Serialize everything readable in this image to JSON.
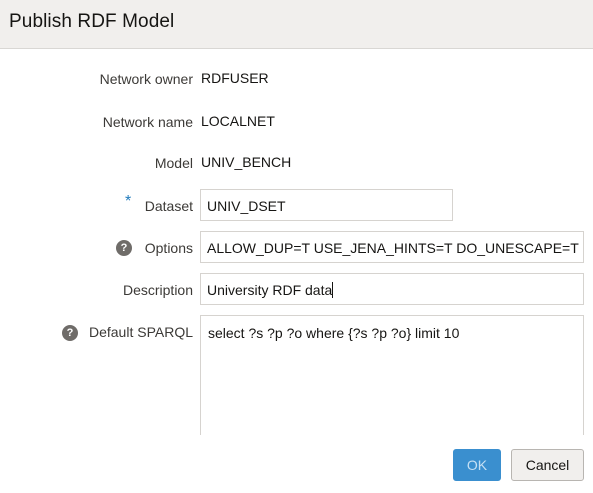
{
  "dialog": {
    "title": "Publish RDF Model"
  },
  "form": {
    "network_owner": {
      "label": "Network owner",
      "value": "RDFUSER"
    },
    "network_name": {
      "label": "Network name",
      "value": "LOCALNET"
    },
    "model": {
      "label": "Model",
      "value": "UNIV_BENCH"
    },
    "dataset": {
      "label": "Dataset",
      "required_marker": "*",
      "value": "UNIV_DSET"
    },
    "options": {
      "label": "Options",
      "help_glyph": "?",
      "value": "ALLOW_DUP=T USE_JENA_HINTS=T DO_UNESCAPE=T"
    },
    "description": {
      "label": "Description",
      "value": "University RDF data"
    },
    "default_sparql": {
      "label": "Default SPARQL",
      "help_glyph": "?",
      "value": "select ?s ?p ?o where {?s ?p ?o} limit 10"
    }
  },
  "buttons": {
    "ok": "OK",
    "cancel": "Cancel"
  },
  "colors": {
    "header_bg": "#f1efed",
    "required_marker": "#227bbc",
    "ok_button_bg": "#3a8fcf",
    "help_icon_bg": "#6f6c69"
  },
  "icons": {
    "help": "question-circle-icon",
    "required": "asterisk-icon"
  }
}
